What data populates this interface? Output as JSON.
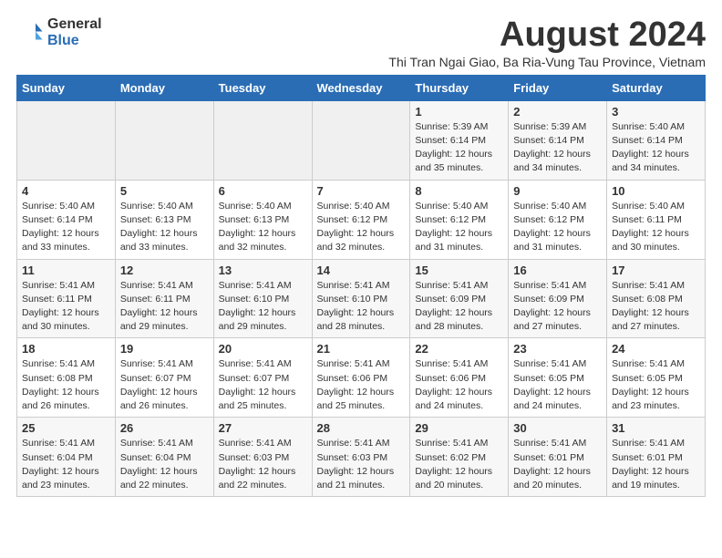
{
  "logo": {
    "general": "General",
    "blue": "Blue"
  },
  "header": {
    "month_year": "August 2024",
    "subtitle": "Thi Tran Ngai Giao, Ba Ria-Vung Tau Province, Vietnam"
  },
  "weekdays": [
    "Sunday",
    "Monday",
    "Tuesday",
    "Wednesday",
    "Thursday",
    "Friday",
    "Saturday"
  ],
  "weeks": [
    [
      {
        "day": "",
        "info": ""
      },
      {
        "day": "",
        "info": ""
      },
      {
        "day": "",
        "info": ""
      },
      {
        "day": "",
        "info": ""
      },
      {
        "day": "1",
        "info": "Sunrise: 5:39 AM\nSunset: 6:14 PM\nDaylight: 12 hours\nand 35 minutes."
      },
      {
        "day": "2",
        "info": "Sunrise: 5:39 AM\nSunset: 6:14 PM\nDaylight: 12 hours\nand 34 minutes."
      },
      {
        "day": "3",
        "info": "Sunrise: 5:40 AM\nSunset: 6:14 PM\nDaylight: 12 hours\nand 34 minutes."
      }
    ],
    [
      {
        "day": "4",
        "info": "Sunrise: 5:40 AM\nSunset: 6:14 PM\nDaylight: 12 hours\nand 33 minutes."
      },
      {
        "day": "5",
        "info": "Sunrise: 5:40 AM\nSunset: 6:13 PM\nDaylight: 12 hours\nand 33 minutes."
      },
      {
        "day": "6",
        "info": "Sunrise: 5:40 AM\nSunset: 6:13 PM\nDaylight: 12 hours\nand 32 minutes."
      },
      {
        "day": "7",
        "info": "Sunrise: 5:40 AM\nSunset: 6:12 PM\nDaylight: 12 hours\nand 32 minutes."
      },
      {
        "day": "8",
        "info": "Sunrise: 5:40 AM\nSunset: 6:12 PM\nDaylight: 12 hours\nand 31 minutes."
      },
      {
        "day": "9",
        "info": "Sunrise: 5:40 AM\nSunset: 6:12 PM\nDaylight: 12 hours\nand 31 minutes."
      },
      {
        "day": "10",
        "info": "Sunrise: 5:40 AM\nSunset: 6:11 PM\nDaylight: 12 hours\nand 30 minutes."
      }
    ],
    [
      {
        "day": "11",
        "info": "Sunrise: 5:41 AM\nSunset: 6:11 PM\nDaylight: 12 hours\nand 30 minutes."
      },
      {
        "day": "12",
        "info": "Sunrise: 5:41 AM\nSunset: 6:11 PM\nDaylight: 12 hours\nand 29 minutes."
      },
      {
        "day": "13",
        "info": "Sunrise: 5:41 AM\nSunset: 6:10 PM\nDaylight: 12 hours\nand 29 minutes."
      },
      {
        "day": "14",
        "info": "Sunrise: 5:41 AM\nSunset: 6:10 PM\nDaylight: 12 hours\nand 28 minutes."
      },
      {
        "day": "15",
        "info": "Sunrise: 5:41 AM\nSunset: 6:09 PM\nDaylight: 12 hours\nand 28 minutes."
      },
      {
        "day": "16",
        "info": "Sunrise: 5:41 AM\nSunset: 6:09 PM\nDaylight: 12 hours\nand 27 minutes."
      },
      {
        "day": "17",
        "info": "Sunrise: 5:41 AM\nSunset: 6:08 PM\nDaylight: 12 hours\nand 27 minutes."
      }
    ],
    [
      {
        "day": "18",
        "info": "Sunrise: 5:41 AM\nSunset: 6:08 PM\nDaylight: 12 hours\nand 26 minutes."
      },
      {
        "day": "19",
        "info": "Sunrise: 5:41 AM\nSunset: 6:07 PM\nDaylight: 12 hours\nand 26 minutes."
      },
      {
        "day": "20",
        "info": "Sunrise: 5:41 AM\nSunset: 6:07 PM\nDaylight: 12 hours\nand 25 minutes."
      },
      {
        "day": "21",
        "info": "Sunrise: 5:41 AM\nSunset: 6:06 PM\nDaylight: 12 hours\nand 25 minutes."
      },
      {
        "day": "22",
        "info": "Sunrise: 5:41 AM\nSunset: 6:06 PM\nDaylight: 12 hours\nand 24 minutes."
      },
      {
        "day": "23",
        "info": "Sunrise: 5:41 AM\nSunset: 6:05 PM\nDaylight: 12 hours\nand 24 minutes."
      },
      {
        "day": "24",
        "info": "Sunrise: 5:41 AM\nSunset: 6:05 PM\nDaylight: 12 hours\nand 23 minutes."
      }
    ],
    [
      {
        "day": "25",
        "info": "Sunrise: 5:41 AM\nSunset: 6:04 PM\nDaylight: 12 hours\nand 23 minutes."
      },
      {
        "day": "26",
        "info": "Sunrise: 5:41 AM\nSunset: 6:04 PM\nDaylight: 12 hours\nand 22 minutes."
      },
      {
        "day": "27",
        "info": "Sunrise: 5:41 AM\nSunset: 6:03 PM\nDaylight: 12 hours\nand 22 minutes."
      },
      {
        "day": "28",
        "info": "Sunrise: 5:41 AM\nSunset: 6:03 PM\nDaylight: 12 hours\nand 21 minutes."
      },
      {
        "day": "29",
        "info": "Sunrise: 5:41 AM\nSunset: 6:02 PM\nDaylight: 12 hours\nand 20 minutes."
      },
      {
        "day": "30",
        "info": "Sunrise: 5:41 AM\nSunset: 6:01 PM\nDaylight: 12 hours\nand 20 minutes."
      },
      {
        "day": "31",
        "info": "Sunrise: 5:41 AM\nSunset: 6:01 PM\nDaylight: 12 hours\nand 19 minutes."
      }
    ]
  ]
}
